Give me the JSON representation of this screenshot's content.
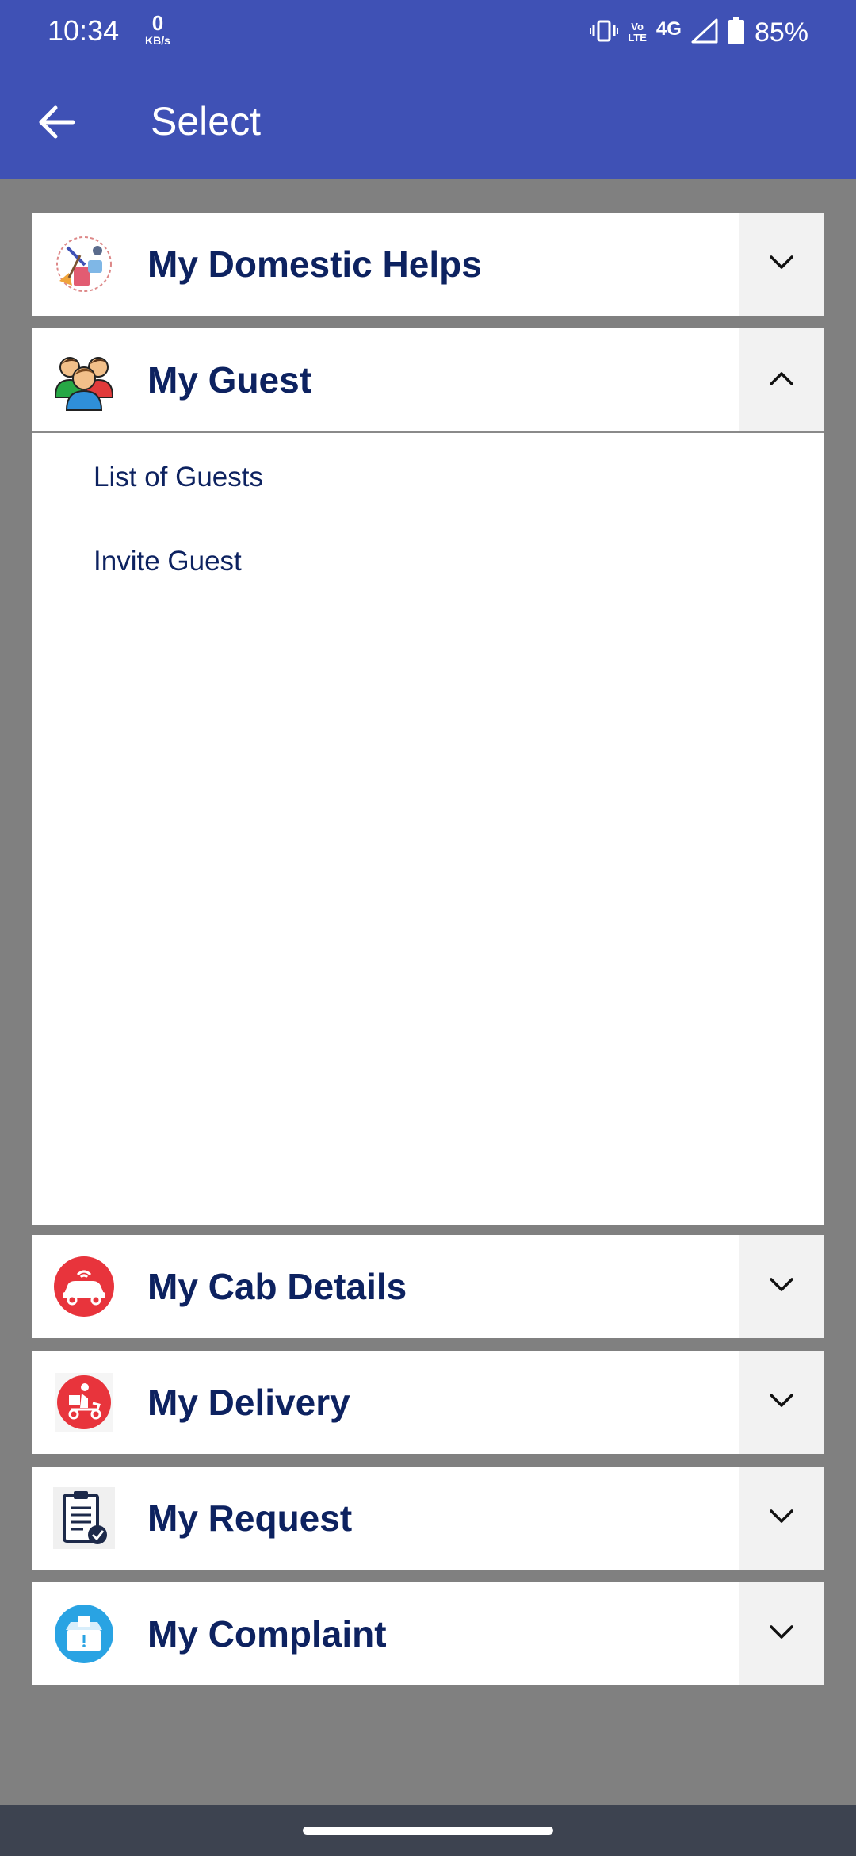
{
  "status_bar": {
    "time": "10:34",
    "net_speed_value": "0",
    "net_speed_unit": "KB/s",
    "volte_top": "Vo",
    "volte_bottom": "LTE",
    "network": "4G",
    "battery": "85%"
  },
  "app_bar": {
    "title": "Select",
    "back_icon": "arrow-left-icon",
    "background": "#3f51b5"
  },
  "sections": [
    {
      "title": "My Domestic Helps",
      "icon": "domestic-help-icon",
      "expanded": false
    },
    {
      "title": "My Guest",
      "icon": "guests-icon",
      "expanded": true,
      "items": [
        "List of Guests",
        "Invite Guest"
      ]
    },
    {
      "title": "My Cab Details",
      "icon": "cab-icon",
      "expanded": false
    },
    {
      "title": "My Delivery",
      "icon": "delivery-scooter-icon",
      "expanded": false
    },
    {
      "title": "My Request",
      "icon": "request-clipboard-icon",
      "expanded": false
    },
    {
      "title": "My Complaint",
      "icon": "complaint-box-icon",
      "expanded": false
    }
  ],
  "colors": {
    "title_text": "#0d2260",
    "page_background": "#808080",
    "accent": "#3f51b5"
  }
}
